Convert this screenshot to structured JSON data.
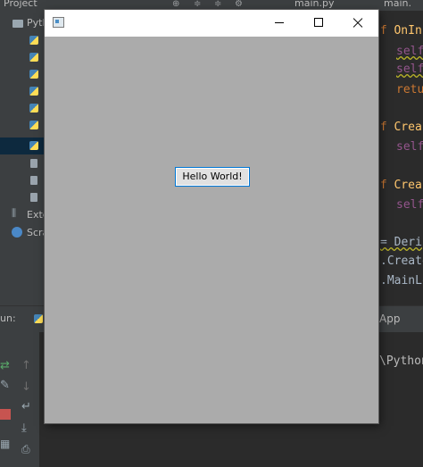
{
  "ide": {
    "project_tab_label": "Project",
    "editor_tabs": [
      "main.py",
      "main."
    ],
    "project_tree": {
      "root_label": "Pyth",
      "external_label": "Exte",
      "scratches_label": "Scra"
    },
    "code_lines": [
      {
        "prefix": "ef ",
        "name": "OnIn"
      },
      {
        "text": "self"
      },
      {
        "text": "self"
      },
      {
        "text": "retu"
      },
      {
        "prefix": "ef ",
        "name": "Crea"
      },
      {
        "text": "self"
      },
      {
        "prefix": "ef ",
        "name": "Crea"
      },
      {
        "text": "self"
      },
      {
        "text": "= Deri"
      },
      {
        "text": ".Create"
      },
      {
        "text": ".MainLo"
      }
    ],
    "run_header_label": "un:",
    "run_tab_label": "App",
    "run_output": "\\Python"
  },
  "tk_window": {
    "title": "",
    "button_label": "Hello World!",
    "background": "#ababab"
  }
}
